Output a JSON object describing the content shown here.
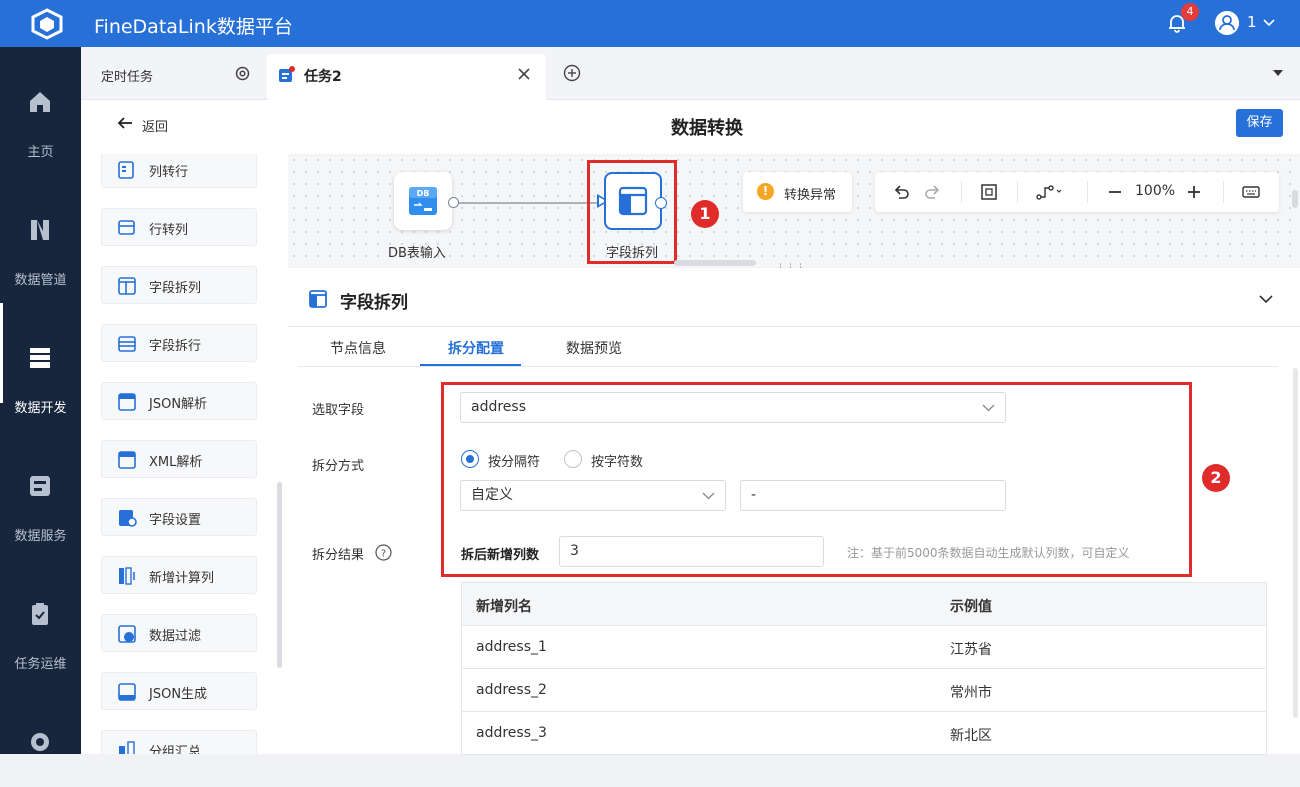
{
  "app": {
    "title": "FineDataLink数据平台",
    "notification_count": "4",
    "user_name": "1"
  },
  "nav": {
    "items": [
      {
        "label": "主页",
        "icon": "home-icon"
      },
      {
        "label": "数据管道",
        "icon": "pipeline-icon"
      },
      {
        "label": "数据开发",
        "icon": "dev-icon",
        "active": true
      },
      {
        "label": "数据服务",
        "icon": "service-icon"
      },
      {
        "label": "任务运维",
        "icon": "ops-icon"
      },
      {
        "label": "",
        "icon": "gear-icon"
      }
    ]
  },
  "tabs": {
    "scheduled": "定时任务",
    "task": "任务2"
  },
  "header": {
    "back": "返回",
    "title": "数据转换",
    "save": "保存"
  },
  "operators": [
    {
      "label": "列转行",
      "icon": "col-to-row-icon"
    },
    {
      "label": "行转列",
      "icon": "row-to-col-icon"
    },
    {
      "label": "字段拆列",
      "icon": "split-col-icon"
    },
    {
      "label": "字段拆行",
      "icon": "split-row-icon"
    },
    {
      "label": "JSON解析",
      "icon": "json-parse-icon"
    },
    {
      "label": "XML解析",
      "icon": "xml-parse-icon"
    },
    {
      "label": "字段设置",
      "icon": "field-setting-icon"
    },
    {
      "label": "新增计算列",
      "icon": "calc-col-icon"
    },
    {
      "label": "数据过滤",
      "icon": "filter-icon"
    },
    {
      "label": "JSON生成",
      "icon": "json-gen-icon"
    },
    {
      "label": "分组汇总",
      "icon": "group-sum-icon"
    }
  ],
  "canvas": {
    "node_db": "DB表输入",
    "node_split": "字段拆列",
    "warning": "转换异常",
    "zoom": "100%",
    "marker1": "1",
    "marker2": "2"
  },
  "panel": {
    "title": "字段拆列",
    "tabs": [
      "节点信息",
      "拆分配置",
      "数据预览"
    ],
    "active_tab": "拆分配置",
    "field_label": "选取字段",
    "field_value": "address",
    "method_label": "拆分方式",
    "radio1": "按分隔符",
    "radio2": "按字符数",
    "delimiter_type": "自定义",
    "delimiter_value": "-",
    "result_label": "拆分结果",
    "new_cols_label": "拆后新增列数",
    "new_cols_value": "3",
    "note": "注：基于前5000条数据自动生成默认列数，可自定义"
  },
  "table": {
    "headers": [
      "新增列名",
      "示例值"
    ],
    "rows": [
      [
        "address_1",
        "江苏省"
      ],
      [
        "address_2",
        "常州市"
      ],
      [
        "address_3",
        "新北区"
      ]
    ]
  },
  "colors": {
    "primary": "#2670d8",
    "nav_bg": "#17253d",
    "highlight": "#e02b2b",
    "warning": "#f5a623"
  }
}
